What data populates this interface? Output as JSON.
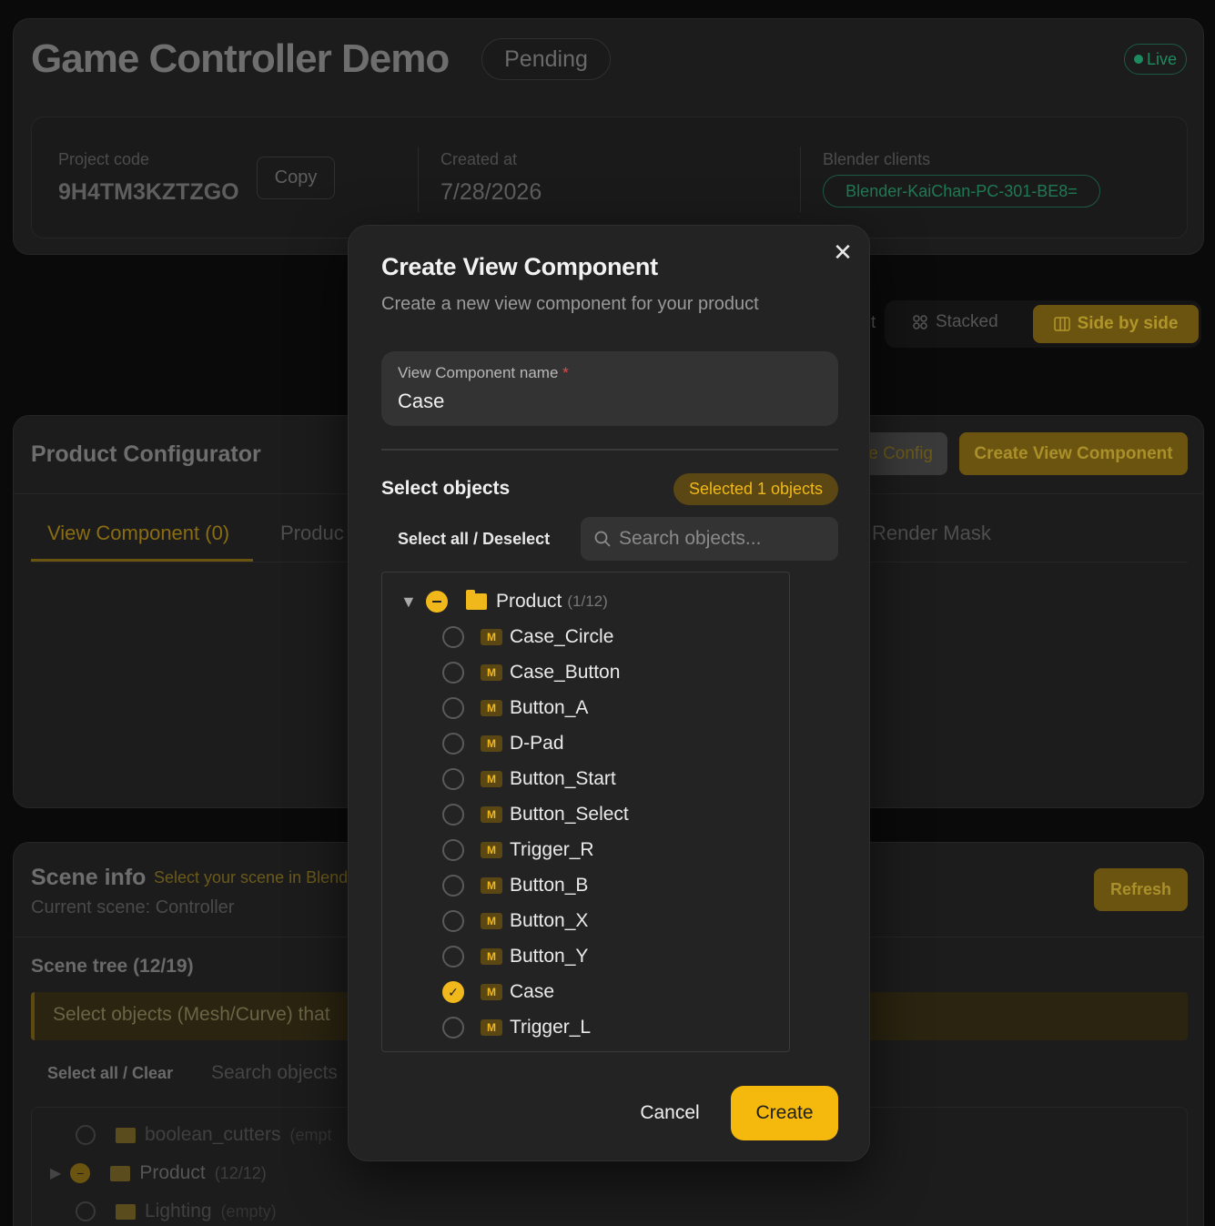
{
  "header": {
    "title": "Game Controller Demo",
    "status": "Pending",
    "live": "Live"
  },
  "meta": {
    "project_code_label": "Project code",
    "project_code": "9H4TM3KZTZGO",
    "copy_label": "Copy",
    "created_label": "Created at",
    "created_value": "7/28/2026",
    "clients_label": "Blender clients",
    "client": "Blender-KaiChan-PC-301-BE8="
  },
  "view_toggle": {
    "left_fragment": "t",
    "stacked": "Stacked",
    "side_by_side": "Side by side"
  },
  "configurator": {
    "title": "Product Configurator",
    "config_button": "e Config",
    "create_view_button": "Create View Component",
    "tabs": [
      "View Component (0)",
      "Produc",
      "Render Mask"
    ]
  },
  "scene": {
    "title": "Scene info",
    "hint": "Select your scene in Blend",
    "current": "Current scene: Controller",
    "refresh": "Refresh",
    "tree_title": "Scene tree (12/19)",
    "banner": "Select objects (Mesh/Curve) that",
    "select_all_clear": "Select all / Clear",
    "search_placeholder": "Search objects",
    "rows": [
      {
        "label": "boolean_cutters",
        "count": "(empt"
      },
      {
        "label": "Product",
        "count": "(12/12)"
      },
      {
        "label": "Lighting",
        "count": "(empty)"
      }
    ]
  },
  "modal": {
    "title": "Create View Component",
    "subtitle": "Create a new view component for your product",
    "field_label": "View Component name",
    "required_mark": "*",
    "field_value": "Case",
    "select_objects": "Select objects",
    "selected_badge": "Selected 1 objects",
    "select_all_deselect": "Select all / Deselect",
    "search_placeholder": "Search objects...",
    "tree": {
      "root_label": "Product",
      "root_count": "(1/12)",
      "items": [
        {
          "label": "Case_Circle",
          "checked": false
        },
        {
          "label": "Case_Button",
          "checked": false
        },
        {
          "label": "Button_A",
          "checked": false
        },
        {
          "label": "D-Pad",
          "checked": false
        },
        {
          "label": "Button_Start",
          "checked": false
        },
        {
          "label": "Button_Select",
          "checked": false
        },
        {
          "label": "Trigger_R",
          "checked": false
        },
        {
          "label": "Button_B",
          "checked": false
        },
        {
          "label": "Button_X",
          "checked": false
        },
        {
          "label": "Button_Y",
          "checked": false
        },
        {
          "label": "Case",
          "checked": true
        },
        {
          "label": "Trigger_L",
          "checked": false
        }
      ],
      "mesh_icon_letter": "M"
    },
    "cancel": "Cancel",
    "create": "Create"
  },
  "colors": {
    "accent": "#f5b80c",
    "live_green": "#1e8a5f",
    "modal_bg": "#232323"
  }
}
